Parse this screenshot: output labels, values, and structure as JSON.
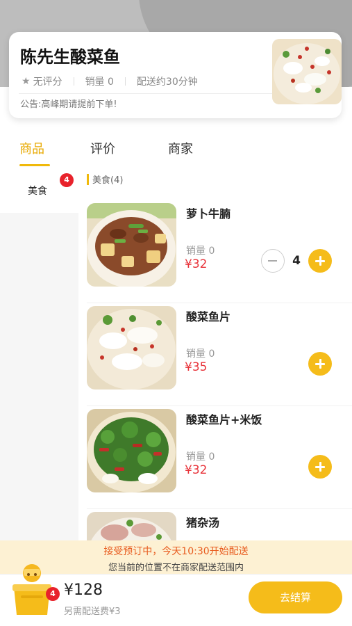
{
  "shop": {
    "name": "陈先生酸菜鱼",
    "rating": "无评分",
    "sales": "销量 0",
    "delivery_time": "配送约30分钟",
    "notice": "公告:高峰期请提前下单!"
  },
  "tabs": [
    {
      "label": "商品",
      "active": true
    },
    {
      "label": "评价",
      "active": false
    },
    {
      "label": "商家",
      "active": false
    }
  ],
  "sidebar": {
    "categories": [
      {
        "label": "美食",
        "badge": "4"
      }
    ]
  },
  "section": {
    "title": "美食(4)"
  },
  "items": [
    {
      "name": "萝卜牛腩",
      "sales": "销量 0",
      "price": "¥32",
      "quantity": "4"
    },
    {
      "name": "酸菜鱼片",
      "sales": "销量 0",
      "price": "¥35"
    },
    {
      "name": "酸菜鱼片+米饭",
      "sales": "销量 0",
      "price": "¥32"
    },
    {
      "name": "猪杂汤"
    }
  ],
  "notice_bar": {
    "line1": "接受预订中，今天10:30开始配送",
    "line2": "您当前的位置不在商家配送范围内"
  },
  "cart": {
    "badge": "4",
    "total": "¥128",
    "delivery_fee": "另需配送费¥3",
    "checkout_label": "去结算"
  },
  "colors": {
    "accent": "#f5bc1a",
    "price": "#e8343b",
    "badge": "#e8222b",
    "notice_bg": "#fdf1d3",
    "notice_text": "#e85c1f"
  },
  "icons": [
    "star-icon",
    "chevron-down-icon",
    "plus-icon",
    "minus-icon",
    "cart-icon"
  ]
}
